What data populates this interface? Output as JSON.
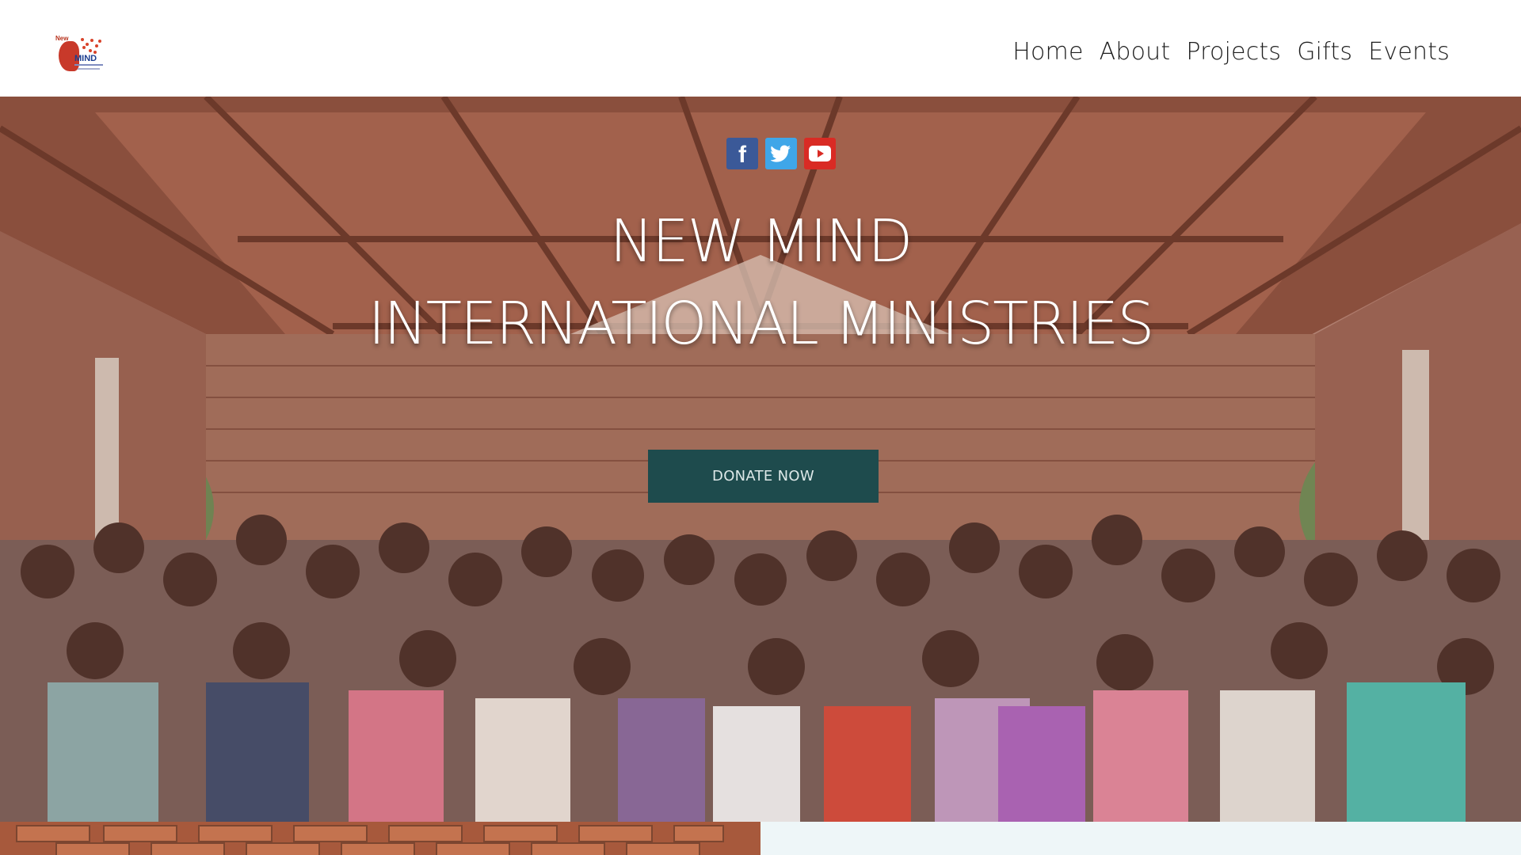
{
  "header": {
    "logo": {
      "line1": "New",
      "line2": "MIND"
    },
    "nav": [
      {
        "label": "Home"
      },
      {
        "label": "About"
      },
      {
        "label": "Projects"
      },
      {
        "label": "Gifts"
      },
      {
        "label": "Events"
      }
    ]
  },
  "hero": {
    "social": [
      {
        "name": "facebook-icon",
        "glyph": "f"
      },
      {
        "name": "twitter-icon",
        "glyph": "twitter-bird"
      },
      {
        "name": "youtube-icon",
        "glyph": "play"
      }
    ],
    "title_line1": "NEW MIND",
    "title_line2": "INTERNATIONAL MINISTRIES",
    "donate_label": "DONATE NOW"
  },
  "colors": {
    "donate_bg": "#1e4b4d",
    "facebook": "#3b5998",
    "twitter": "#3fa6e8",
    "youtube": "#d92b24",
    "strip_right": "#eef6f8"
  }
}
